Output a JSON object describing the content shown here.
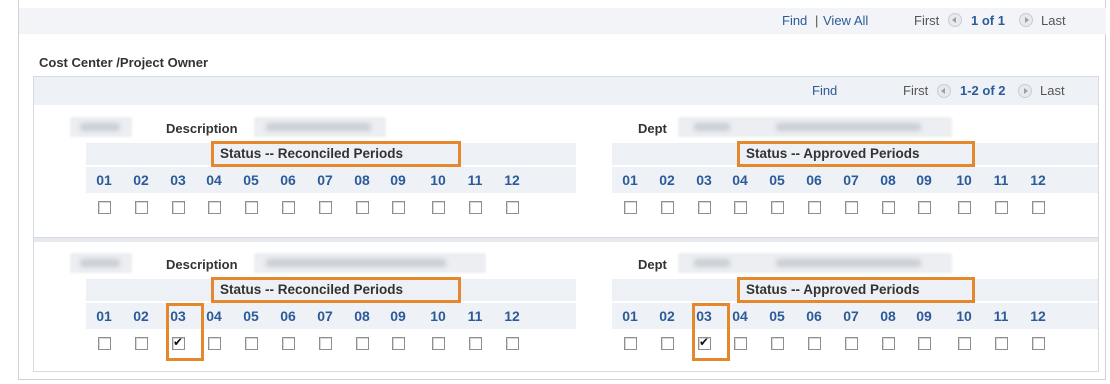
{
  "top_nav": {
    "find": "Find",
    "separator": "|",
    "view_all": "View All",
    "first": "First",
    "page_indicator": "1 of 1",
    "last": "Last"
  },
  "section_title": "Cost Center /Project Owner",
  "grid_nav": {
    "find": "Find",
    "first": "First",
    "page_indicator": "1-2 of 2",
    "last": "Last"
  },
  "periods": [
    "01",
    "02",
    "03",
    "04",
    "05",
    "06",
    "07",
    "08",
    "09",
    "10",
    "11",
    "12"
  ],
  "rows": [
    {
      "description_label": "Description",
      "dept_label": "Dept",
      "reconciled_title": "Status -- Reconciled Periods",
      "approved_title": "Status -- Approved Periods",
      "reconciled_checked": [
        false,
        false,
        false,
        false,
        false,
        false,
        false,
        false,
        false,
        false,
        false,
        false
      ],
      "approved_checked": [
        false,
        false,
        false,
        false,
        false,
        false,
        false,
        false,
        false,
        false,
        false,
        false
      ]
    },
    {
      "description_label": "Description",
      "dept_label": "Dept",
      "reconciled_title": "Status -- Reconciled Periods",
      "approved_title": "Status -- Approved Periods",
      "reconciled_checked": [
        false,
        false,
        true,
        false,
        false,
        false,
        false,
        false,
        false,
        false,
        false,
        false
      ],
      "approved_checked": [
        false,
        false,
        true,
        false,
        false,
        false,
        false,
        false,
        false,
        false,
        false,
        false
      ]
    }
  ],
  "colors": {
    "highlight": "#e5872c",
    "link": "#2d5b9a",
    "band": "#eef1f5"
  }
}
